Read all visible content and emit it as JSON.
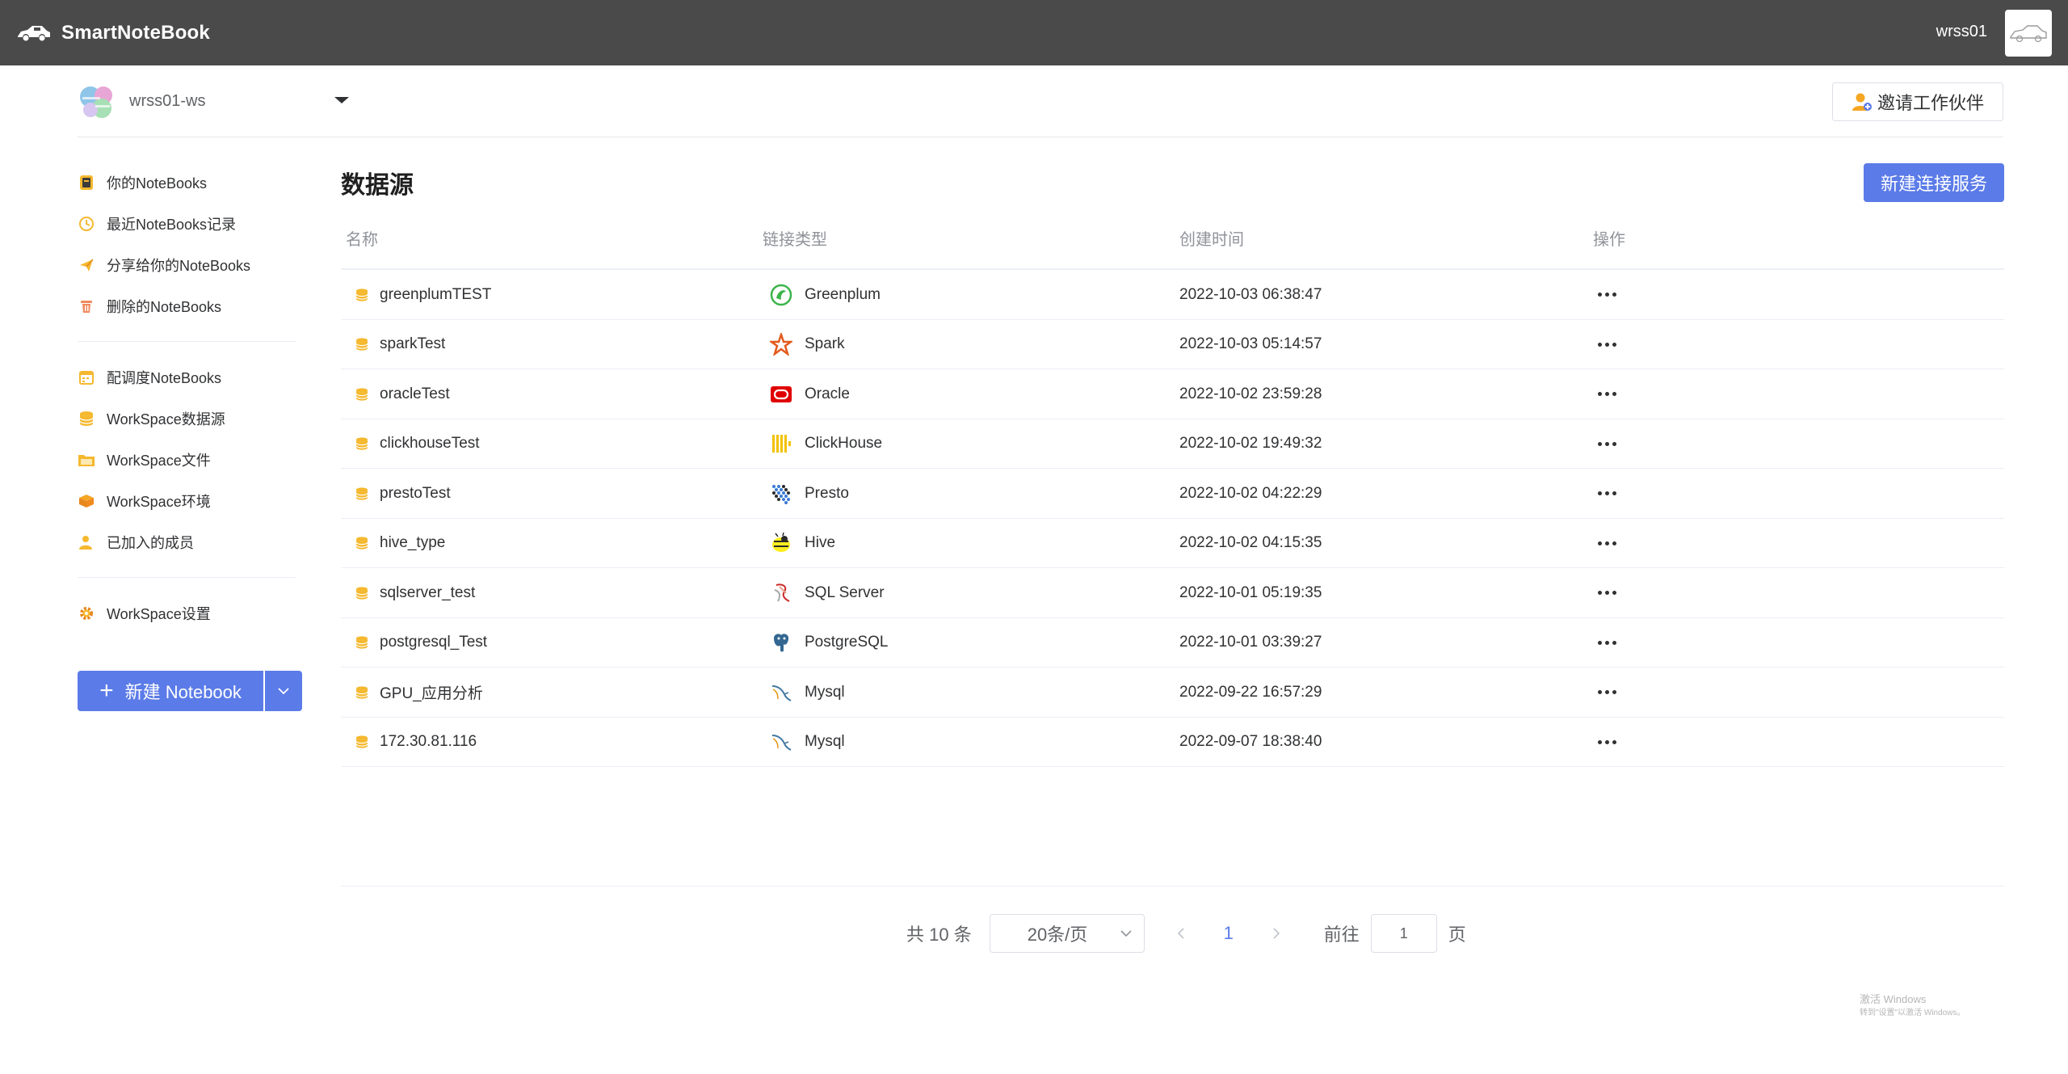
{
  "app": {
    "name": "SmartNoteBook",
    "user": "wrss01"
  },
  "workspace": {
    "name": "wrss01-ws",
    "invite_label": "邀请工作伙伴"
  },
  "sidebar": {
    "groups": [
      [
        {
          "label": "你的NoteBooks",
          "icon": "notebook-icon"
        },
        {
          "label": "最近NoteBooks记录",
          "icon": "clock-icon"
        },
        {
          "label": "分享给你的NoteBooks",
          "icon": "share-icon"
        },
        {
          "label": "删除的NoteBooks",
          "icon": "trash-icon"
        }
      ],
      [
        {
          "label": "配调度NoteBooks",
          "icon": "calendar-icon"
        },
        {
          "label": "WorkSpace数据源",
          "icon": "database-icon"
        },
        {
          "label": "WorkSpace文件",
          "icon": "folder-icon"
        },
        {
          "label": "WorkSpace环境",
          "icon": "box-icon"
        },
        {
          "label": "已加入的成员",
          "icon": "member-icon"
        }
      ],
      [
        {
          "label": "WorkSpace设置",
          "icon": "gear-icon"
        }
      ]
    ],
    "new_notebook_label": "新建 Notebook"
  },
  "main": {
    "title": "数据源",
    "create_label": "新建连接服务",
    "columns": [
      "名称",
      "链接类型",
      "创建时间",
      "操作"
    ],
    "rows": [
      {
        "name": "greenplumTEST",
        "type": "Greenplum",
        "type_icon": "greenplum-icon",
        "created": "2022-10-03 06:38:47"
      },
      {
        "name": "sparkTest",
        "type": "Spark",
        "type_icon": "spark-icon",
        "created": "2022-10-03 05:14:57"
      },
      {
        "name": "oracleTest",
        "type": "Oracle",
        "type_icon": "oracle-icon",
        "created": "2022-10-02 23:59:28"
      },
      {
        "name": "clickhouseTest",
        "type": "ClickHouse",
        "type_icon": "clickhouse-icon",
        "created": "2022-10-02 19:49:32"
      },
      {
        "name": "prestoTest",
        "type": "Presto",
        "type_icon": "presto-icon",
        "created": "2022-10-02 04:22:29"
      },
      {
        "name": "hive_type",
        "type": "Hive",
        "type_icon": "hive-icon",
        "created": "2022-10-02 04:15:35"
      },
      {
        "name": "sqlserver_test",
        "type": "SQL Server",
        "type_icon": "sqlserver-icon",
        "created": "2022-10-01 05:19:35"
      },
      {
        "name": "postgresql_Test",
        "type": "PostgreSQL",
        "type_icon": "postgresql-icon",
        "created": "2022-10-01 03:39:27"
      },
      {
        "name": "GPU_应用分析",
        "type": "Mysql",
        "type_icon": "mysql-icon",
        "created": "2022-09-22 16:57:29"
      },
      {
        "name": "172.30.81.116",
        "type": "Mysql",
        "type_icon": "mysql-icon",
        "created": "2022-09-07 18:38:40"
      }
    ]
  },
  "pagination": {
    "total": "共 10 条",
    "page_size": "20条/页",
    "current_page": "1",
    "goto_prefix": "前往",
    "goto_value": "1",
    "goto_suffix": "页"
  },
  "watermark": {
    "line1": "激活 Windows",
    "line2": "转到\"设置\"以激活 Windows。"
  },
  "colors": {
    "topbar": "#4a4a4a",
    "primary": "#5b7be8",
    "db_yellow": "#f5b82e"
  }
}
